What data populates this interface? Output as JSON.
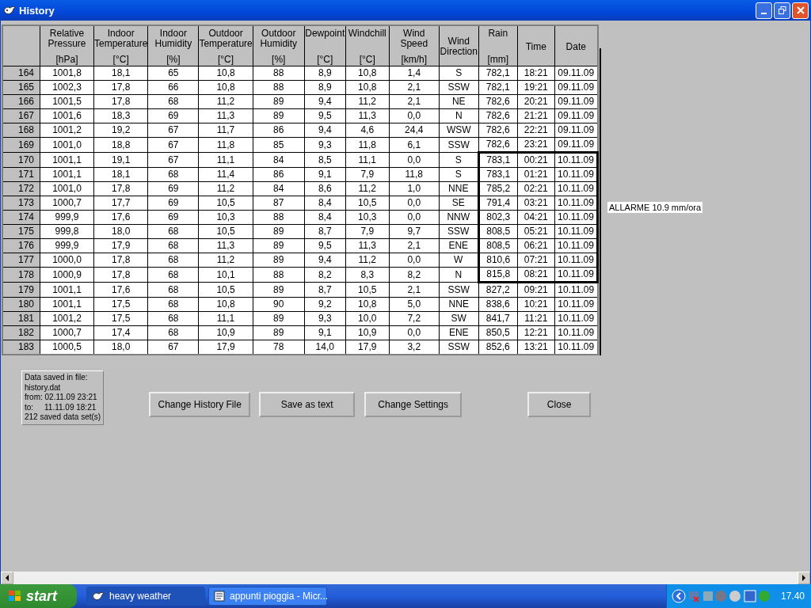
{
  "window": {
    "title": "History"
  },
  "table": {
    "columns": [
      {
        "label": "Relative\nPressure",
        "unit": "[hPa]"
      },
      {
        "label": "Indoor\nTemperature",
        "unit": "[°C]"
      },
      {
        "label": "Indoor\nHumidity",
        "unit": "[%]"
      },
      {
        "label": "Outdoor\nTemperature",
        "unit": "[°C]"
      },
      {
        "label": "Outdoor\nHumidity",
        "unit": "[%]"
      },
      {
        "label": "Dewpoint",
        "unit": "[°C]"
      },
      {
        "label": "Windchill",
        "unit": "[°C]"
      },
      {
        "label": "Wind\nSpeed",
        "unit": "[km/h]"
      },
      {
        "label": "Wind\nDirection"
      },
      {
        "label": "Rain",
        "unit": "[mm]"
      },
      {
        "label": "Time"
      },
      {
        "label": "Date"
      }
    ],
    "rows": [
      {
        "number": "164",
        "alarm": false,
        "cells": [
          "1001,8",
          "18,1",
          "65",
          "10,8",
          "88",
          "8,9",
          "10,8",
          "1,4",
          "S",
          "782,1",
          "18:21",
          "09.11.09"
        ]
      },
      {
        "number": "165",
        "alarm": false,
        "cells": [
          "1002,3",
          "17,8",
          "66",
          "10,8",
          "88",
          "8,9",
          "10,8",
          "2,1",
          "SSW",
          "782,1",
          "19:21",
          "09.11.09"
        ]
      },
      {
        "number": "166",
        "alarm": false,
        "cells": [
          "1001,5",
          "17,8",
          "68",
          "11,2",
          "89",
          "9,4",
          "11,2",
          "2,1",
          "NE",
          "782,6",
          "20:21",
          "09.11.09"
        ]
      },
      {
        "number": "167",
        "alarm": false,
        "cells": [
          "1001,6",
          "18,3",
          "69",
          "11,3",
          "89",
          "9,5",
          "11,3",
          "0,0",
          "N",
          "782,6",
          "21:21",
          "09.11.09"
        ]
      },
      {
        "number": "168",
        "alarm": false,
        "cells": [
          "1001,2",
          "19,2",
          "67",
          "11,7",
          "86",
          "9,4",
          "4,6",
          "24,4",
          "WSW",
          "782,6",
          "22:21",
          "09.11.09"
        ]
      },
      {
        "number": "169",
        "alarm": false,
        "cells": [
          "1001,0",
          "18,8",
          "67",
          "11,8",
          "85",
          "9,3",
          "11,8",
          "6,1",
          "SSW",
          "782,6",
          "23:21",
          "09.11.09"
        ]
      },
      {
        "number": "170",
        "alarm": true,
        "cells": [
          "1001,1",
          "19,1",
          "67",
          "11,1",
          "84",
          "8,5",
          "11,1",
          "0,0",
          "S",
          "783,1",
          "00:21",
          "10.11.09"
        ]
      },
      {
        "number": "171",
        "alarm": true,
        "cells": [
          "1001,1",
          "18,1",
          "68",
          "11,4",
          "86",
          "9,1",
          "7,9",
          "11,8",
          "S",
          "783,1",
          "01:21",
          "10.11.09"
        ]
      },
      {
        "number": "172",
        "alarm": true,
        "cells": [
          "1001,0",
          "17,8",
          "69",
          "11,2",
          "84",
          "8,6",
          "11,2",
          "1,0",
          "NNE",
          "785,2",
          "02:21",
          "10.11.09"
        ]
      },
      {
        "number": "173",
        "alarm": true,
        "cells": [
          "1000,7",
          "17,7",
          "69",
          "10,5",
          "87",
          "8,4",
          "10,5",
          "0,0",
          "SE",
          "791,4",
          "03:21",
          "10.11.09"
        ]
      },
      {
        "number": "174",
        "alarm": true,
        "cells": [
          "999,9",
          "17,6",
          "69",
          "10,3",
          "88",
          "8,4",
          "10,3",
          "0,0",
          "NNW",
          "802,3",
          "04:21",
          "10.11.09"
        ]
      },
      {
        "number": "175",
        "alarm": true,
        "cells": [
          "999,8",
          "18,0",
          "68",
          "10,5",
          "89",
          "8,7",
          "7,9",
          "9,7",
          "SSW",
          "808,5",
          "05:21",
          "10.11.09"
        ]
      },
      {
        "number": "176",
        "alarm": true,
        "cells": [
          "999,9",
          "17,9",
          "68",
          "11,3",
          "89",
          "9,5",
          "11,3",
          "2,1",
          "ENE",
          "808,5",
          "06:21",
          "10.11.09"
        ]
      },
      {
        "number": "177",
        "alarm": true,
        "cells": [
          "1000,0",
          "17,8",
          "68",
          "11,2",
          "89",
          "9,4",
          "11,2",
          "0,0",
          "W",
          "810,6",
          "07:21",
          "10.11.09"
        ]
      },
      {
        "number": "178",
        "alarm": true,
        "cells": [
          "1000,9",
          "17,8",
          "68",
          "10,1",
          "88",
          "8,2",
          "8,3",
          "8,2",
          "N",
          "815,8",
          "08:21",
          "10.11.09"
        ]
      },
      {
        "number": "179",
        "alarm": false,
        "cells": [
          "1001,1",
          "17,6",
          "68",
          "10,5",
          "89",
          "8,7",
          "10,5",
          "2,1",
          "SSW",
          "827,2",
          "09:21",
          "10.11.09"
        ]
      },
      {
        "number": "180",
        "alarm": false,
        "cells": [
          "1001,1",
          "17,5",
          "68",
          "10,8",
          "90",
          "9,2",
          "10,8",
          "5,0",
          "NNE",
          "838,6",
          "10:21",
          "10.11.09"
        ]
      },
      {
        "number": "181",
        "alarm": false,
        "cells": [
          "1001,2",
          "17,5",
          "68",
          "11,1",
          "89",
          "9,3",
          "10,0",
          "7,2",
          "SW",
          "841,7",
          "11:21",
          "10.11.09"
        ]
      },
      {
        "number": "182",
        "alarm": false,
        "cells": [
          "1000,7",
          "17,4",
          "68",
          "10,9",
          "89",
          "9,1",
          "10,9",
          "0,0",
          "ENE",
          "850,5",
          "12:21",
          "10.11.09"
        ]
      },
      {
        "number": "183",
        "alarm": false,
        "cells": [
          "1000,5",
          "18,0",
          "67",
          "17,9",
          "78",
          "14,0",
          "17,9",
          "3,2",
          "SSW",
          "852,6",
          "13:21",
          "10.11.09"
        ]
      }
    ]
  },
  "alarm_note": "ALLARME 10.9 mm/ora",
  "file_info": [
    "Data saved in file:",
    "history.dat",
    "from: 02.11.09 23:21",
    "to:     11.11.09 18:21",
    "212 saved data set(s)"
  ],
  "buttons": [
    "Change History File",
    "Save as text",
    "Change Settings",
    "Close"
  ],
  "taskbar": {
    "start": "start",
    "tasks": [
      {
        "label": "heavy weather",
        "selected": true
      },
      {
        "label": "appunti pioggia - Micr...",
        "selected": false
      }
    ],
    "clock": "17.40"
  }
}
